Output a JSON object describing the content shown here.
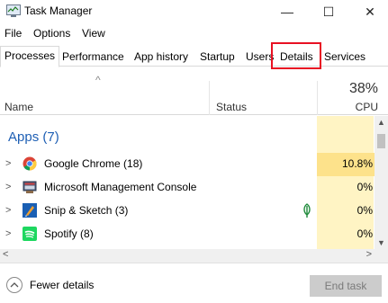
{
  "window": {
    "title": "Task Manager",
    "minimize_glyph": "—",
    "maximize_glyph": "☐",
    "close_glyph": "✕"
  },
  "menu": [
    "File",
    "Options",
    "View"
  ],
  "tabs": [
    "Processes",
    "Performance",
    "App history",
    "Startup",
    "Users",
    "Details",
    "Services"
  ],
  "active_tab": "Processes",
  "highlighted_tab": "Details",
  "columns": {
    "sort_glyph": "^",
    "name": "Name",
    "status": "Status",
    "cpu_total": "38%",
    "cpu": "CPU"
  },
  "group": {
    "title": "Apps (7)"
  },
  "processes": [
    {
      "name": "Google Chrome (18)",
      "icon": "chrome-icon",
      "status_icon": "",
      "cpu": "10.8%"
    },
    {
      "name": "Microsoft Management Console",
      "icon": "mmc-icon",
      "status_icon": "",
      "cpu": "0%"
    },
    {
      "name": "Snip & Sketch (3)",
      "icon": "snip-sketch-icon",
      "status_icon": "leaf-suspended-icon",
      "cpu": "0%"
    },
    {
      "name": "Spotify (8)",
      "icon": "spotify-icon",
      "status_icon": "",
      "cpu": "0%"
    }
  ],
  "footer": {
    "fewer_details": "Fewer details",
    "end_task": "End task"
  },
  "colors": {
    "group_title": "#1e5fb4",
    "cpu_column": "#fff4c4",
    "cpu_high": "#fde28b",
    "highlight": "#e81123"
  }
}
